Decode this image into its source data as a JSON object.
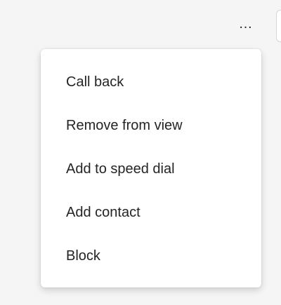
{
  "toolbar": {
    "more_label": "…",
    "more_icon": "more-horizontal-icon"
  },
  "menu": {
    "items": [
      {
        "label": "Call back"
      },
      {
        "label": "Remove from view"
      },
      {
        "label": "Add to speed dial"
      },
      {
        "label": "Add contact"
      },
      {
        "label": "Block"
      }
    ]
  },
  "colors": {
    "background": "#f5f5f5",
    "menu_background": "#ffffff",
    "text": "#242424"
  }
}
